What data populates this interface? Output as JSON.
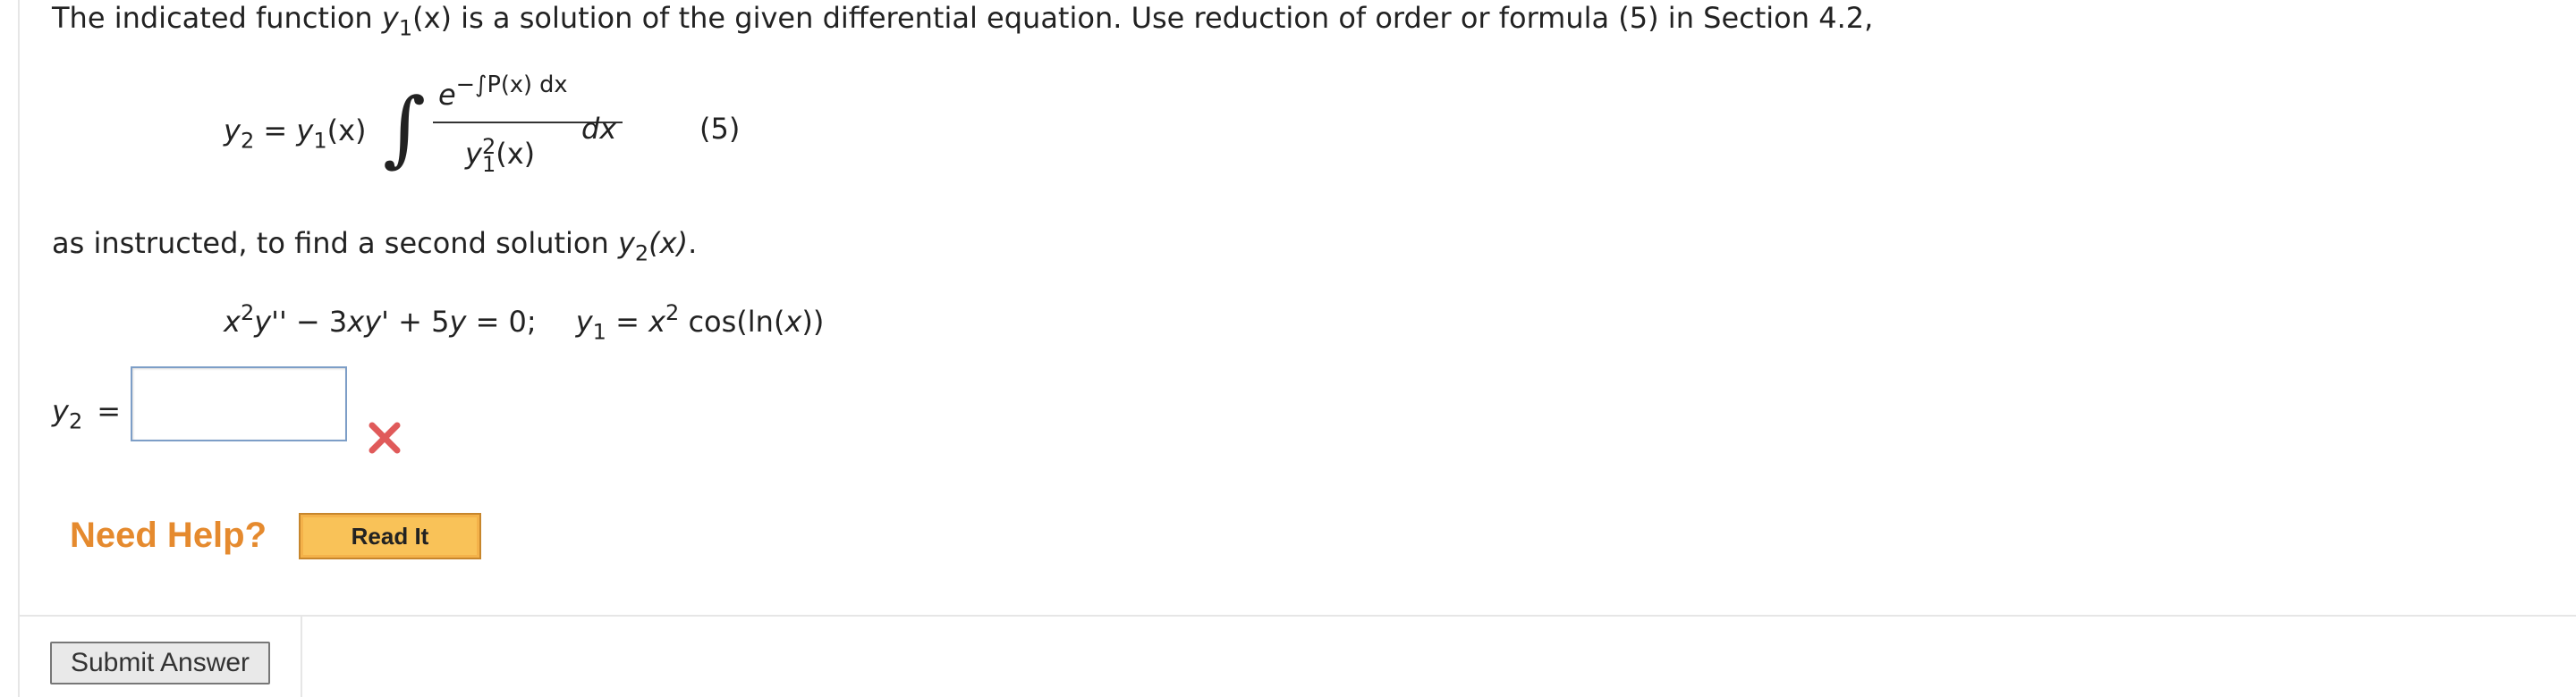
{
  "intro": {
    "line1_part1": "The indicated function ",
    "y1": "y",
    "y1_sub": "1",
    "y1_arg": "(x)",
    "line1_part2": " is a solution of the given differential equation. Use reduction of order or formula (5) in Section 4.2,"
  },
  "formula": {
    "lhs_var": "y",
    "lhs_sub": "2",
    "equals": " = ",
    "rhs_var": "y",
    "rhs_sub": "1",
    "rhs_arg": "(x)",
    "integral_sign": "∫",
    "numerator_base": "e",
    "numerator_exp": "−∫P(x) dx",
    "denominator_var": "y",
    "denominator_sup": "2",
    "denominator_sub": "1",
    "denominator_arg": "(x)",
    "differential": "dx",
    "number": "(5)"
  },
  "instruction": {
    "part1": "as instructed, to find a second solution ",
    "var": "y",
    "sub": "2",
    "arg": "(x)",
    "part2": "."
  },
  "equation": {
    "x": "x",
    "x_sup": "2",
    "y2prime": "y''",
    "minus": " − 3",
    "xyprime": "xy'",
    "plus": " + 5",
    "y": "y",
    "eq0": " = 0;",
    "y1_var": "y",
    "y1_sub": "1",
    "eq": " = ",
    "x2": "x",
    "x2_sup": "2",
    "cos": " cos(ln(",
    "cos_x": "x",
    "close": "))"
  },
  "answer": {
    "label_var": "y",
    "label_sub": "2",
    "label_eq": "=",
    "value": "",
    "status": "incorrect",
    "status_color": "#e05a5a"
  },
  "help": {
    "need_help": "Need Help?",
    "read_it": "Read It"
  },
  "submit": {
    "label": "Submit Answer"
  }
}
